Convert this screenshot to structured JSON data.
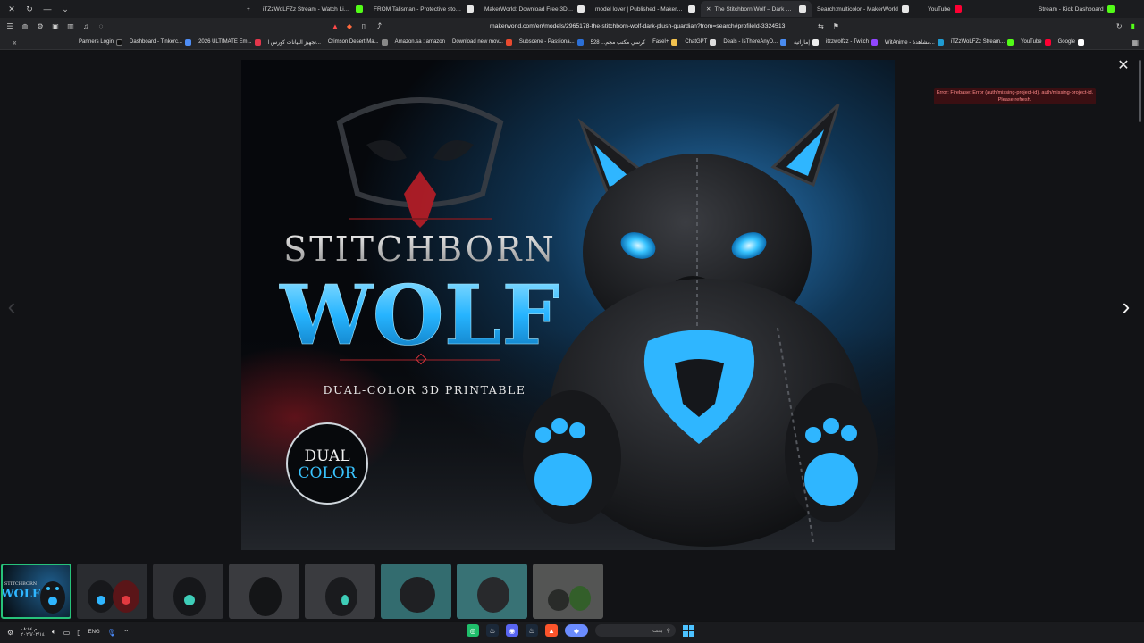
{
  "browser": {
    "tabs": [
      {
        "label": "iTZzWoLFZz Stream - Watch Live on",
        "color": "#53fc18"
      },
      {
        "label": "FROM Talisman - Protective stone m",
        "color": "#e6e6e6"
      },
      {
        "label": "MakerWorld: Download Free 3D Mo",
        "color": "#e6e6e6"
      },
      {
        "label": "model lover | Published - MakerWo",
        "color": "#e6e6e6"
      },
      {
        "label": "The Stitchborn Wolf – Dark Plush",
        "color": "#e6e6e6",
        "active": true
      },
      {
        "label": "Search:multicolor - MakerWorld",
        "color": "#e6e6e6"
      },
      {
        "label": "YouTube",
        "color": "#ff0033"
      },
      {
        "label": "Stream - Kick Dashboard",
        "color": "#53fc18"
      }
    ],
    "url": "makerworld.com/en/models/2965178-the-stitchborn-wolf-dark-plush-guardian?from=search#profileId-3324513",
    "bookmarks": [
      "Partners Login",
      "Dashboard - Tinkerc...",
      "2026 ULTIMATE Em...",
      "تجهيز البيانات كورس ا...",
      "Crimson Desert Ma...",
      "Amazon.sa : amazon",
      "Download new mov...",
      "Subscene - Passiona...",
      "كرسي مكتب مجم... 528",
      "Fasel+",
      "ChatGPT",
      "Deals - IsThereAnyD...",
      "إماراتية",
      "itzzwolfzz - Twitch",
      "WitAnime - مشاهدة...",
      "iTZzWoLFZz Stream...",
      "YouTube",
      "Google"
    ]
  },
  "viewer": {
    "error": "Error: Firebase: Error (auth/missing-project-id). auth/missing-project-id. Please refresh.",
    "hero": {
      "title_top": "STITCHBORN",
      "title_main": "WOLF",
      "subtitle": "DUAL-COLOR 3D PRINTABLE",
      "badge_line1": "DUAL",
      "badge_line2": "COLOR"
    },
    "thumb_labels": [
      "STITCHBORN",
      "WOLF"
    ],
    "thumb_count": 8
  },
  "taskbar": {
    "time": "م ٠٨:٥٤",
    "date": "٢٠٢٦/٠٢/١٤",
    "lang": "ENG",
    "search_placeholder": "بحث"
  },
  "colors": {
    "accent_blue": "#2fb6ff",
    "active_green": "#27c27a",
    "error_bg": "#3a0f12"
  }
}
